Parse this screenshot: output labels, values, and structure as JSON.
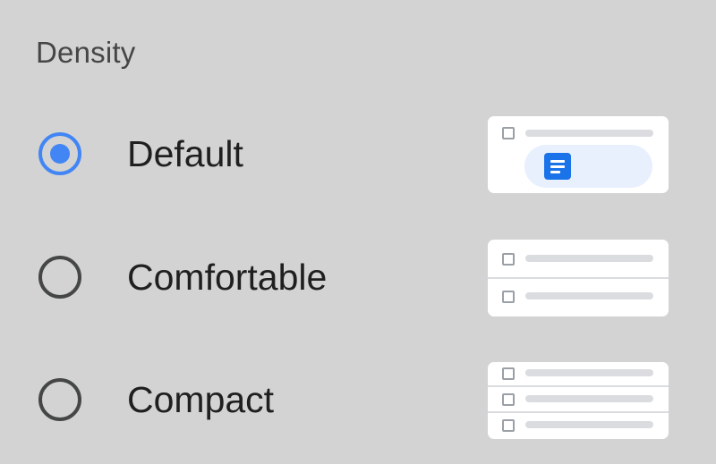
{
  "density": {
    "title": "Density",
    "options": [
      {
        "label": "Default",
        "selected": true,
        "preview": "default-preview-icon"
      },
      {
        "label": "Comfortable",
        "selected": false,
        "preview": "comfortable-preview-icon"
      },
      {
        "label": "Compact",
        "selected": false,
        "preview": "compact-preview-icon"
      }
    ]
  },
  "colors": {
    "accent": "#4285f4",
    "doc_icon": "#1a73e8",
    "chip_bg": "#e8f0fe",
    "background": "#d3d3d3"
  }
}
